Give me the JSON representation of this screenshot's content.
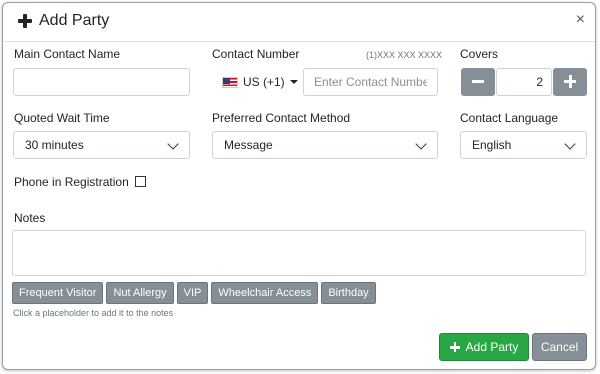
{
  "modal": {
    "title": "Add Party",
    "close_label": "×"
  },
  "fields": {
    "main_contact_name": {
      "label": "Main Contact Name",
      "value": ""
    },
    "contact_number": {
      "label": "Contact Number",
      "format_hint": "(1)XXX XXX XXXX",
      "country_code": "US (+1)",
      "placeholder": "Enter Contact Number",
      "value": ""
    },
    "covers": {
      "label": "Covers",
      "value": "2",
      "minus_label": "−",
      "plus_label": "+"
    },
    "quoted_wait_time": {
      "label": "Quoted Wait Time",
      "value": "30 minutes"
    },
    "preferred_contact_method": {
      "label": "Preferred Contact Method",
      "value": "Message"
    },
    "contact_language": {
      "label": "Contact Language",
      "value": "English"
    },
    "phone_in_registration": {
      "label": "Phone in Registration",
      "checked": false
    },
    "notes": {
      "label": "Notes",
      "value": ""
    }
  },
  "placeholders": {
    "items": [
      "Frequent Visitor",
      "Nut Allergy",
      "VIP",
      "Wheelchair Access",
      "Birthday"
    ],
    "help_text": "Click a placeholder to add it to the notes"
  },
  "actions": {
    "add_label": "Add Party",
    "cancel_label": "Cancel"
  },
  "icons": {
    "title_icon": "plus-icon",
    "close_icon": "close-icon",
    "flag_icon": "us-flag-icon",
    "dropdown_icon": "chevron-down-icon"
  },
  "colors": {
    "primary_add": "#28a745",
    "secondary": "#868e96"
  }
}
